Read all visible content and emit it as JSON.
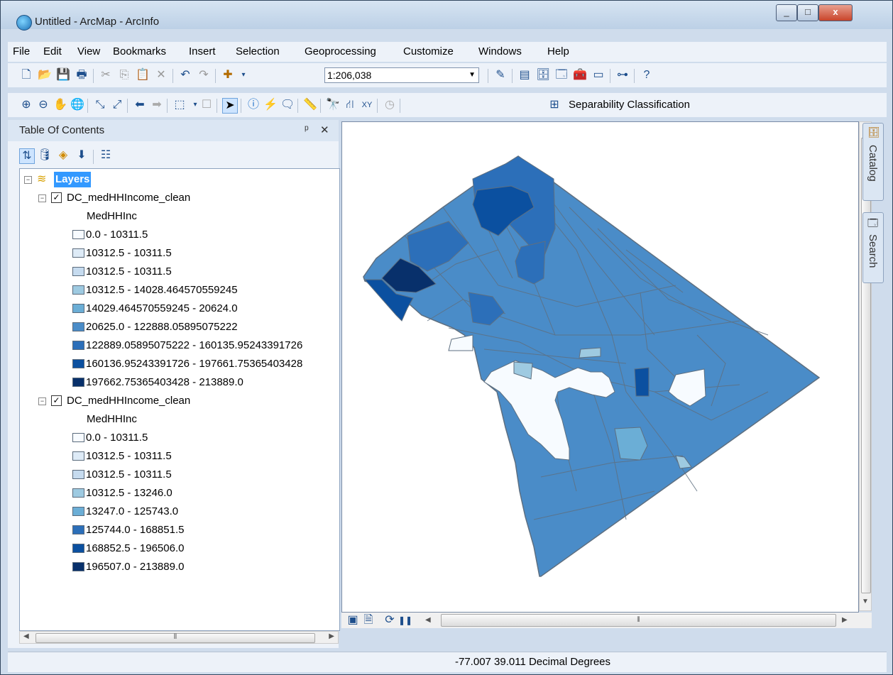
{
  "window": {
    "title": "Untitled - ArcMap - ArcInfo",
    "minimize": "_",
    "maximize": "□",
    "close": "x"
  },
  "menu": [
    "File",
    "Edit",
    "View",
    "Bookmarks",
    "Insert",
    "Selection",
    "Geoprocessing",
    "Customize",
    "Windows",
    "Help"
  ],
  "toolbar": {
    "scale": "1:206,038",
    "separability_label": "Separability Classification"
  },
  "toc": {
    "title": "Table Of Contents",
    "pin": "ᵖ",
    "close": "✕",
    "root_label": "Layers",
    "layers": [
      {
        "name": "DC_medHHIncome_clean",
        "field": "MedHHInc",
        "classes": [
          {
            "label": "0.0 - 10311.5",
            "color": "#f7fbff"
          },
          {
            "label": "10312.5 - 10311.5",
            "color": "#deebf7"
          },
          {
            "label": "10312.5 - 10311.5",
            "color": "#c6dbef"
          },
          {
            "label": "10312.5 - 14028.464570559245",
            "color": "#9ecae1"
          },
          {
            "label": "14029.464570559245 - 20624.0",
            "color": "#6baed6"
          },
          {
            "label": "20625.0 - 122888.05895075222",
            "color": "#4a8cc8"
          },
          {
            "label": "122889.05895075222 - 160135.95243391726",
            "color": "#2c6fb9"
          },
          {
            "label": "160136.95243391726 - 197661.75365403428",
            "color": "#0b50a0"
          },
          {
            "label": "197662.75365403428 - 213889.0",
            "color": "#08306b"
          }
        ]
      },
      {
        "name": "DC_medHHIncome_clean",
        "field": "MedHHInc",
        "classes": [
          {
            "label": "0.0 - 10311.5",
            "color": "#f7fbff"
          },
          {
            "label": "10312.5 - 10311.5",
            "color": "#deebf7"
          },
          {
            "label": "10312.5 - 10311.5",
            "color": "#c6dbef"
          },
          {
            "label": "10312.5 - 13246.0",
            "color": "#9ecae1"
          },
          {
            "label": "13247.0 - 125743.0",
            "color": "#6baed6"
          },
          {
            "label": "125744.0 - 168851.5",
            "color": "#2c6fb9"
          },
          {
            "label": "168852.5 - 196506.0",
            "color": "#0b50a0"
          },
          {
            "label": "196507.0 - 213889.0",
            "color": "#08306b"
          }
        ]
      }
    ]
  },
  "side_tabs": [
    "Catalog",
    "Search"
  ],
  "status": {
    "coords": "-77.007  39.011 Decimal Degrees"
  },
  "map": {
    "base_fill": "#4a8cc8",
    "outline": "#5e6f80"
  }
}
